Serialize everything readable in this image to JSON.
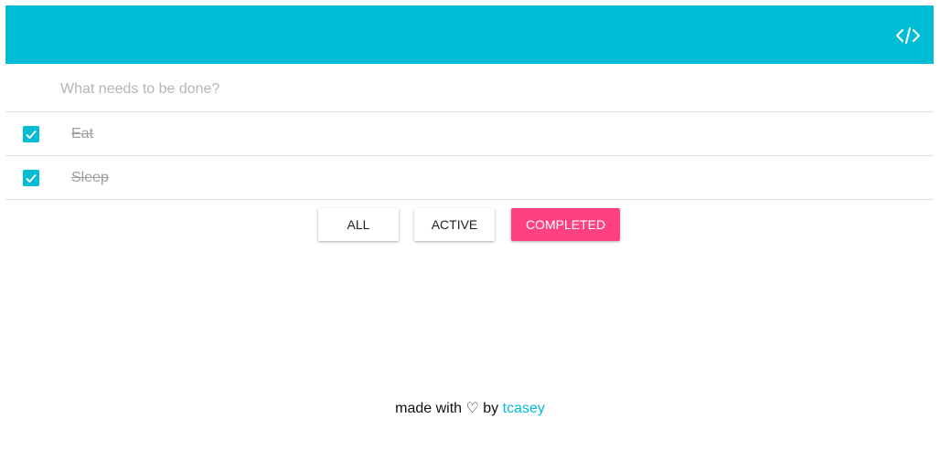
{
  "header": {
    "code_icon": "code-icon"
  },
  "new_todo": {
    "placeholder": "What needs to be done?",
    "value": ""
  },
  "todos": [
    {
      "text": "Eat",
      "completed": true
    },
    {
      "text": "Sleep",
      "completed": true
    }
  ],
  "filters": [
    {
      "label": "ALL",
      "selected": false
    },
    {
      "label": "ACTIVE",
      "selected": false
    },
    {
      "label": "COMPLETED",
      "selected": true
    }
  ],
  "footer": {
    "prefix": "made with",
    "heart": "♡",
    "by": "by",
    "author": "tcasey"
  },
  "colors": {
    "primary": "#00bcd4",
    "accent": "#ff4081",
    "completed_text": "#9e9e9e",
    "divider": "#e0e0e0"
  }
}
